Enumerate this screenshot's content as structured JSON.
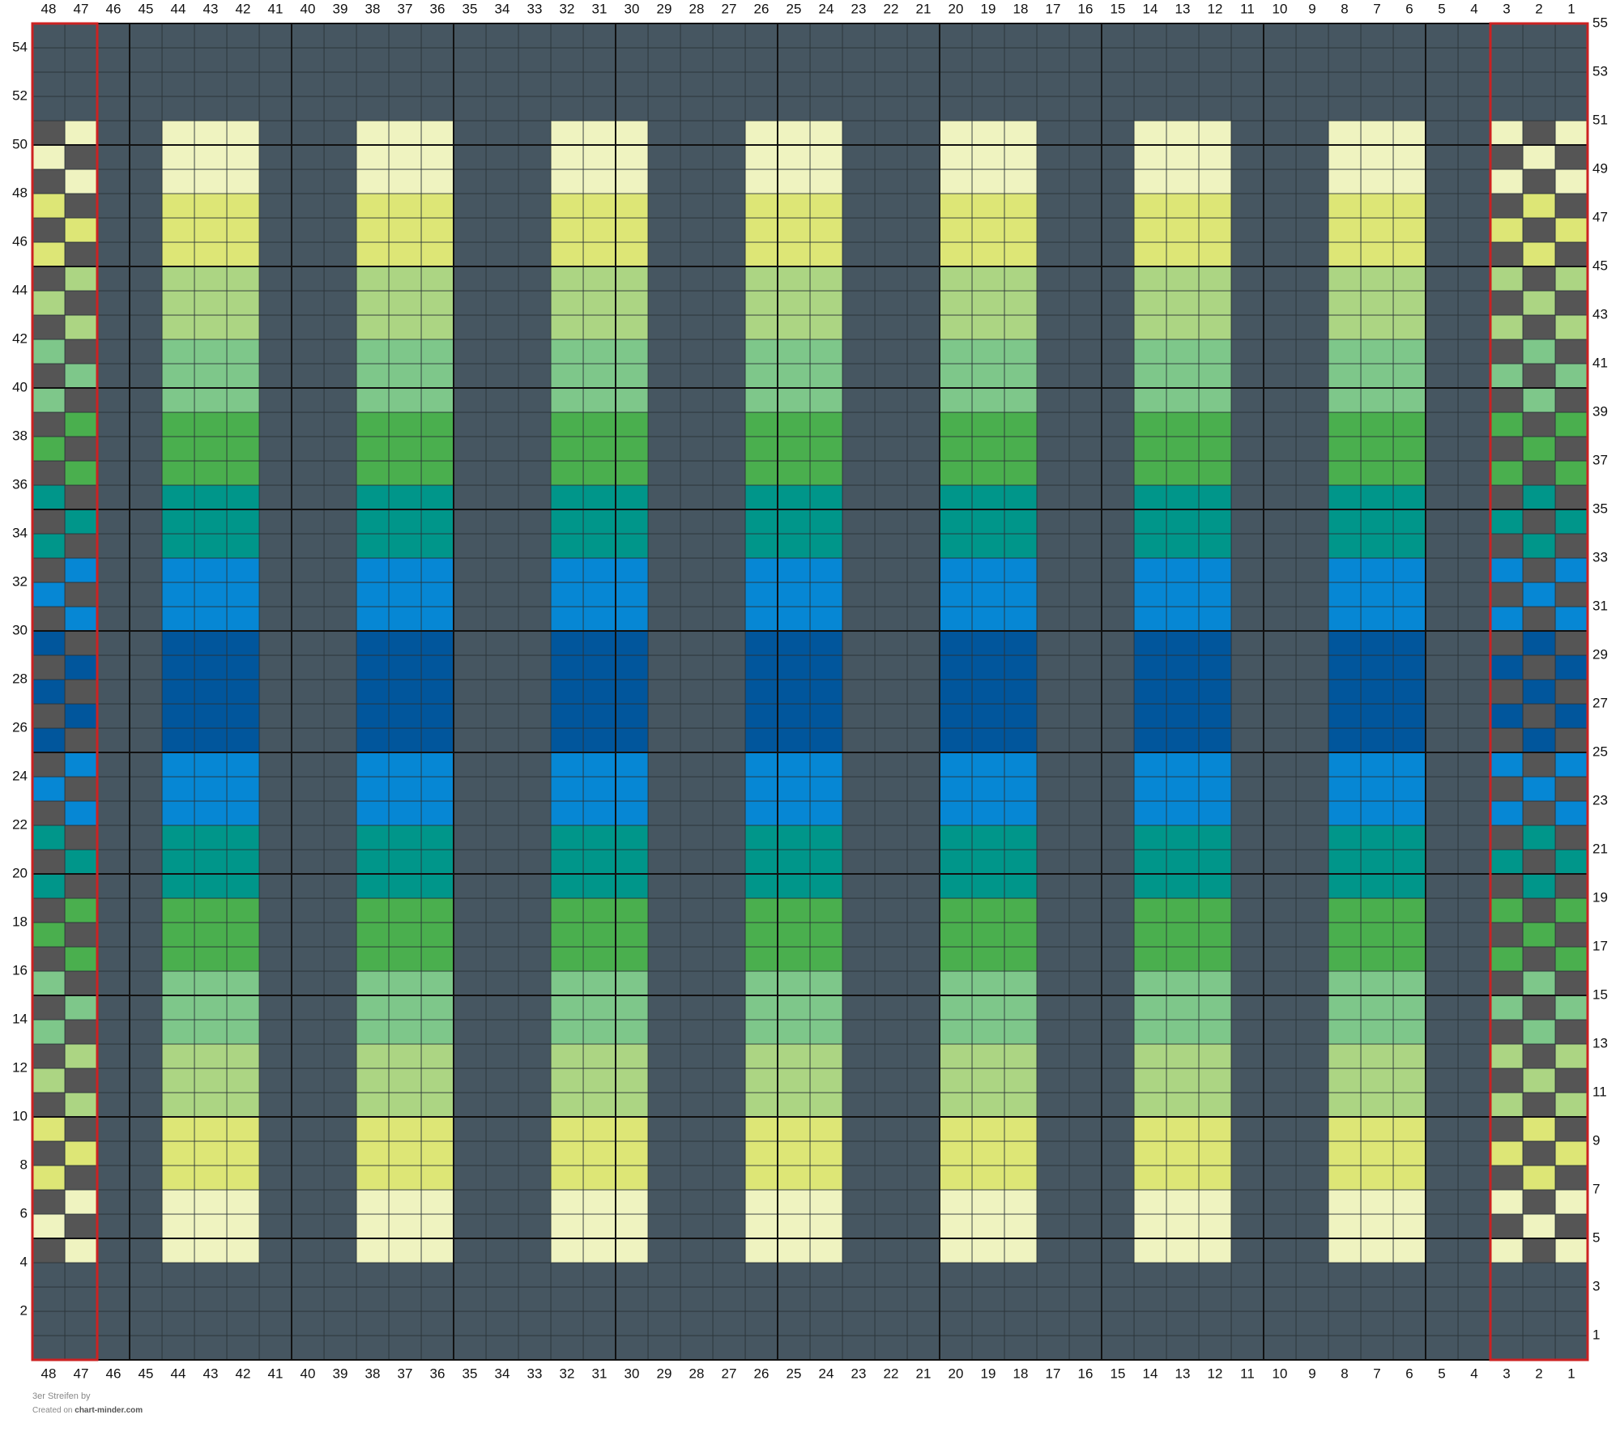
{
  "chart_data": {
    "type": "knitting-chart",
    "columns": 48,
    "rows": 55,
    "column_numbers": {
      "start": 48,
      "end": 1
    },
    "top_labels": [
      48,
      47,
      46,
      45,
      44,
      43,
      42,
      41,
      40,
      39,
      38,
      37,
      36,
      35,
      34,
      33,
      32,
      31,
      30,
      29,
      28,
      27,
      26,
      25,
      24,
      23,
      22,
      21,
      20,
      19,
      18,
      17,
      16,
      15,
      14,
      13,
      12,
      11,
      10,
      9,
      8,
      7,
      6,
      5,
      4,
      3,
      2,
      1
    ],
    "bottom_labels": [
      48,
      47,
      46,
      45,
      44,
      43,
      42,
      41,
      40,
      39,
      38,
      37,
      36,
      35,
      34,
      33,
      32,
      31,
      30,
      29,
      28,
      27,
      26,
      25,
      24,
      23,
      22,
      21,
      20,
      19,
      18,
      17,
      16,
      15,
      14,
      13,
      12,
      11,
      10,
      9,
      8,
      7,
      6,
      5,
      4,
      3,
      2,
      1
    ],
    "left_labels": [
      54,
      52,
      50,
      48,
      46,
      44,
      42,
      40,
      38,
      36,
      34,
      32,
      30,
      28,
      26,
      24,
      22,
      20,
      18,
      16,
      14,
      12,
      10,
      8,
      6,
      4,
      2
    ],
    "right_labels": [
      55,
      53,
      51,
      49,
      47,
      45,
      43,
      41,
      39,
      37,
      35,
      33,
      31,
      29,
      27,
      25,
      23,
      21,
      19,
      17,
      15,
      13,
      11,
      9,
      7,
      5,
      3,
      1
    ],
    "palette": {
      "background": "#465661",
      "checker_dark": "#555555",
      "cream": "#eff3c0",
      "yellow_green": "#dde676",
      "light_green": "#acd583",
      "mint_green": "#7ec78a",
      "green": "#4aaf4e",
      "teal": "#00968a",
      "blue": "#0687d4",
      "dark_blue": "#01569c",
      "grid_line": "#2a3338",
      "major_line": "#111111",
      "border_box": "#cc2222"
    },
    "row_bands": [
      {
        "rows": [
          5,
          7
        ],
        "color": "cream"
      },
      {
        "rows": [
          8,
          10
        ],
        "color": "yellow_green"
      },
      {
        "rows": [
          11,
          13
        ],
        "color": "light_green"
      },
      {
        "rows": [
          14,
          16
        ],
        "color": "mint_green"
      },
      {
        "rows": [
          17,
          19
        ],
        "color": "green"
      },
      {
        "rows": [
          20,
          22
        ],
        "color": "teal"
      },
      {
        "rows": [
          23,
          25
        ],
        "color": "blue"
      },
      {
        "rows": [
          26,
          30
        ],
        "color": "dark_blue"
      },
      {
        "rows": [
          31,
          33
        ],
        "color": "blue"
      },
      {
        "rows": [
          34,
          36
        ],
        "color": "teal"
      },
      {
        "rows": [
          37,
          39
        ],
        "color": "green"
      },
      {
        "rows": [
          40,
          42
        ],
        "color": "mint_green"
      },
      {
        "rows": [
          43,
          45
        ],
        "color": "light_green"
      },
      {
        "rows": [
          46,
          48
        ],
        "color": "yellow_green"
      },
      {
        "rows": [
          49,
          51
        ],
        "color": "cream"
      }
    ],
    "stripe_columns": [
      [
        42,
        44
      ],
      [
        36,
        38
      ],
      [
        30,
        32
      ],
      [
        24,
        26
      ],
      [
        18,
        20
      ],
      [
        12,
        14
      ],
      [
        6,
        8
      ]
    ],
    "checker_columns": [
      1,
      2,
      3,
      47,
      48
    ],
    "checker_rows": [
      5,
      51
    ],
    "border_boxes": [
      [
        47,
        48
      ],
      [
        1,
        3
      ]
    ]
  },
  "footer": {
    "title": "3er Streifen",
    "by": "by",
    "created_on": "Created on",
    "site": "chart-minder.com"
  }
}
